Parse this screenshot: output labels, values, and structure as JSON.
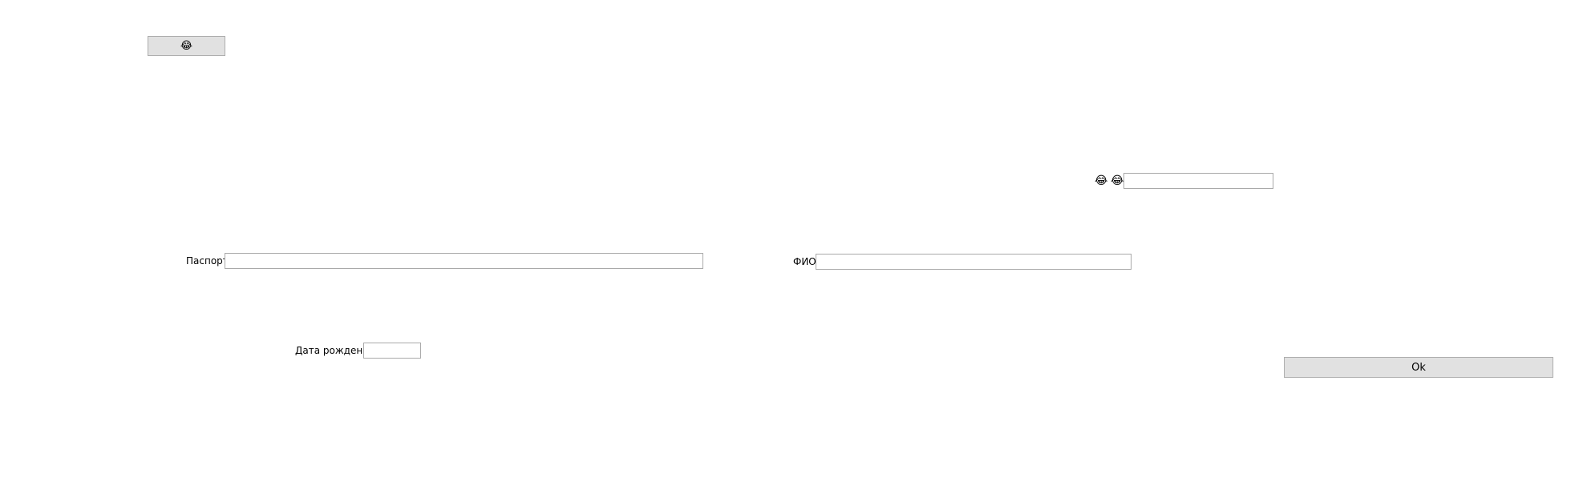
{
  "top_button": {
    "glyph": "😂"
  },
  "passport": {
    "label": "Паспорт",
    "value": ""
  },
  "birthdate": {
    "label": "Дата рождения",
    "value": ""
  },
  "fullname": {
    "label": "ФИО",
    "value": ""
  },
  "emoji_row": {
    "glyph_1": "😂",
    "glyph_2": "😂",
    "value": ""
  },
  "ok_button": {
    "label": "Ok"
  }
}
